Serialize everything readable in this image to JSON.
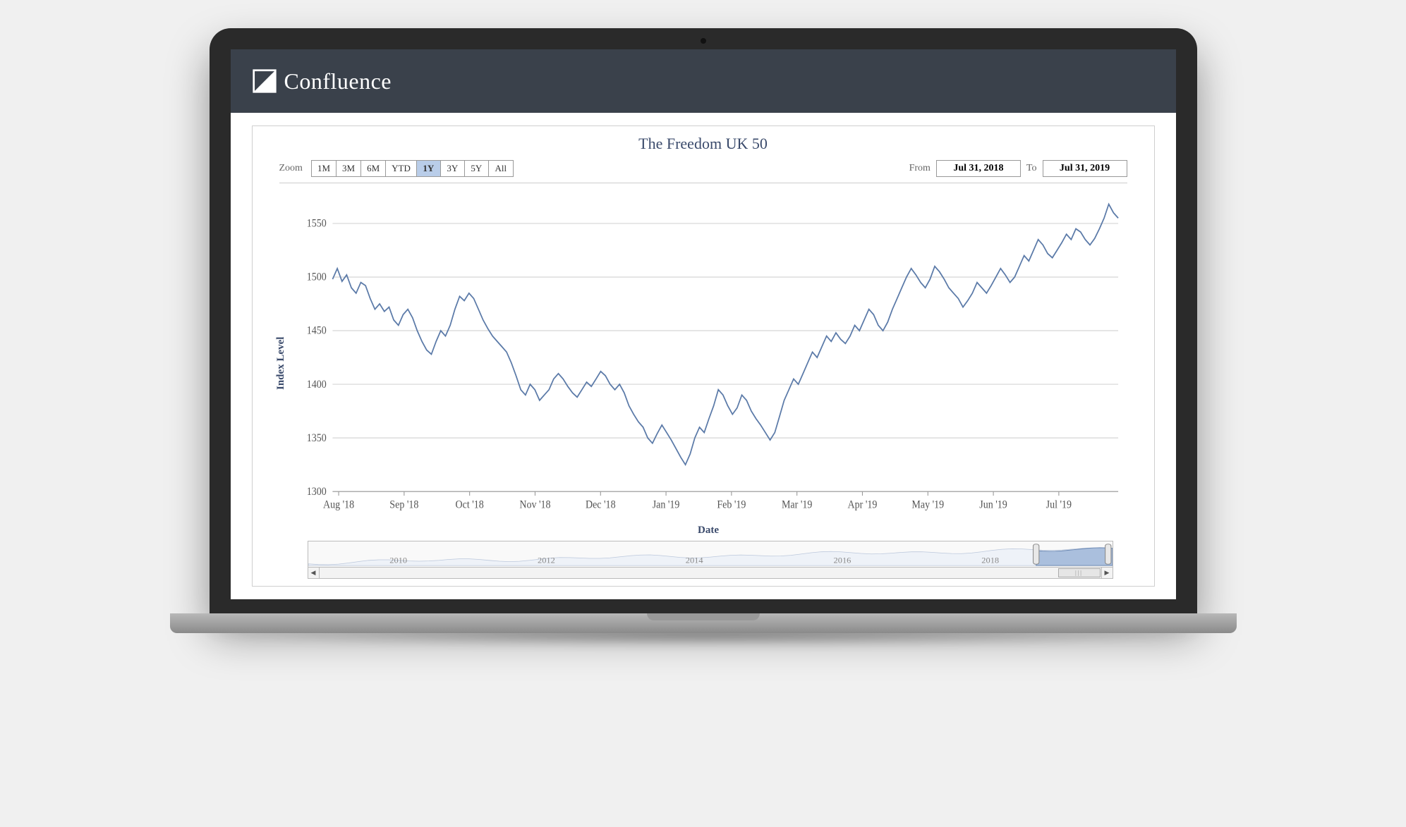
{
  "brand": {
    "name": "Confluence"
  },
  "chart_data": {
    "type": "line",
    "title": "The Freedom UK 50",
    "xlabel": "Date",
    "ylabel": "Index Level",
    "ylim": [
      1300,
      1570
    ],
    "y_ticks": [
      1300,
      1350,
      1400,
      1450,
      1500,
      1550
    ],
    "x_ticks": [
      "Aug '18",
      "Sep '18",
      "Oct '18",
      "Nov '18",
      "Dec '18",
      "Jan '19",
      "Feb '19",
      "Mar '19",
      "Apr '19",
      "May '19",
      "Jun '19",
      "Jul '19"
    ],
    "series": [
      {
        "name": "Index Level",
        "color": "#5b7aa8",
        "values": [
          1498,
          1508,
          1496,
          1502,
          1490,
          1485,
          1495,
          1492,
          1480,
          1470,
          1475,
          1468,
          1472,
          1460,
          1455,
          1465,
          1470,
          1462,
          1450,
          1440,
          1432,
          1428,
          1440,
          1450,
          1445,
          1455,
          1470,
          1482,
          1478,
          1485,
          1480,
          1470,
          1460,
          1452,
          1445,
          1440,
          1435,
          1430,
          1420,
          1408,
          1395,
          1390,
          1400,
          1395,
          1385,
          1390,
          1395,
          1405,
          1410,
          1405,
          1398,
          1392,
          1388,
          1395,
          1402,
          1398,
          1405,
          1412,
          1408,
          1400,
          1395,
          1400,
          1392,
          1380,
          1372,
          1365,
          1360,
          1350,
          1345,
          1354,
          1362,
          1355,
          1348,
          1340,
          1332,
          1325,
          1335,
          1350,
          1360,
          1355,
          1368,
          1380,
          1395,
          1390,
          1380,
          1372,
          1378,
          1390,
          1385,
          1375,
          1368,
          1362,
          1355,
          1348,
          1355,
          1370,
          1385,
          1395,
          1405,
          1400,
          1410,
          1420,
          1430,
          1425,
          1435,
          1445,
          1440,
          1448,
          1442,
          1438,
          1445,
          1455,
          1450,
          1460,
          1470,
          1465,
          1455,
          1450,
          1458,
          1470,
          1480,
          1490,
          1500,
          1508,
          1502,
          1495,
          1490,
          1498,
          1510,
          1505,
          1498,
          1490,
          1485,
          1480,
          1472,
          1478,
          1485,
          1495,
          1490,
          1485,
          1492,
          1500,
          1508,
          1502,
          1495,
          1500,
          1510,
          1520,
          1515,
          1525,
          1535,
          1530,
          1522,
          1518,
          1525,
          1532,
          1540,
          1535,
          1545,
          1542,
          1535,
          1530,
          1536,
          1545,
          1555,
          1568,
          1560,
          1555
        ]
      }
    ]
  },
  "controls": {
    "zoom_label": "Zoom",
    "zoom_options": [
      "1M",
      "3M",
      "6M",
      "YTD",
      "1Y",
      "3Y",
      "5Y",
      "All"
    ],
    "zoom_selected": "1Y",
    "from_label": "From",
    "to_label": "To",
    "from_date": "Jul 31, 2018",
    "to_date": "Jul 31, 2019"
  },
  "navigator": {
    "ticks": [
      "2010",
      "2012",
      "2014",
      "2016",
      "2018"
    ],
    "range_start": 0,
    "range_end": 1,
    "selected_start": 0.905,
    "selected_end": 1.0
  }
}
